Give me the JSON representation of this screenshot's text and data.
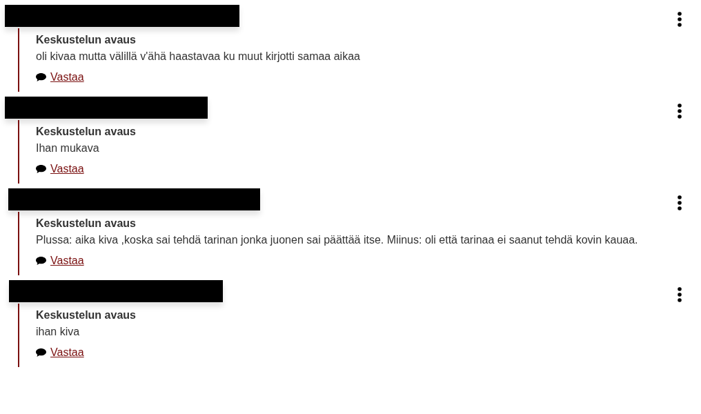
{
  "posts": [
    {
      "title": "Keskustelun avaus",
      "body": "oli kivaa mutta välillä v'ähä haastavaa ku muut kirjotti samaa aikaa",
      "reply": "Vastaa"
    },
    {
      "title": "Keskustelun avaus",
      "body": "Ihan mukava",
      "reply": "Vastaa"
    },
    {
      "title": "Keskustelun avaus",
      "body": "Plussa: aika kiva ,koska sai tehdä tarinan jonka juonen sai päättää itse. Miinus: oli että tarinaa ei saanut tehdä kovin kauaa.",
      "reply": "Vastaa"
    },
    {
      "title": "Keskustelun avaus",
      "body": "ihan kiva",
      "reply": "Vastaa"
    }
  ]
}
